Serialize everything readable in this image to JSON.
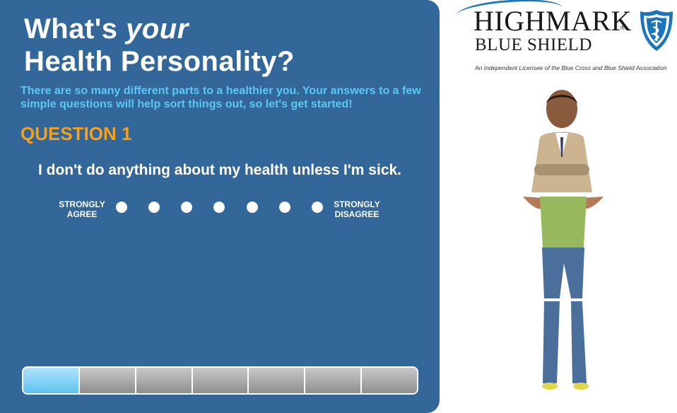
{
  "header": {
    "title_prefix": "What's ",
    "title_emphasis": "your",
    "title_line2": "Health Personality?"
  },
  "intro": {
    "text": "There are so many different parts to a healthier you. Your answers to a few simple questions will help sort things out, so let's get started!"
  },
  "question": {
    "number_label": "QUESTION 1",
    "text": "I don't do anything about my health unless I'm sick."
  },
  "scale": {
    "left_label_line1": "STRONGLY",
    "left_label_line2": "AGREE",
    "right_label_line1": "STRONGLY",
    "right_label_line2": "DISAGREE",
    "options_count": 7
  },
  "progress": {
    "total_steps": 7,
    "current_step": 1
  },
  "brand": {
    "name_line1": "HIGHMARK",
    "registered": "®",
    "name_line2": "BLUE SHIELD",
    "tagline": "An Independent Licensee of the Blue Cross and Blue Shield Association"
  },
  "colors": {
    "panel": "#336699",
    "intro_text": "#5cc8f5",
    "question_number": "#f4a11d",
    "progress_active": "#5ec3f2",
    "brand_blue": "#1b75bb"
  },
  "icons": {
    "logo": "blue-shield-caduceus-icon"
  }
}
